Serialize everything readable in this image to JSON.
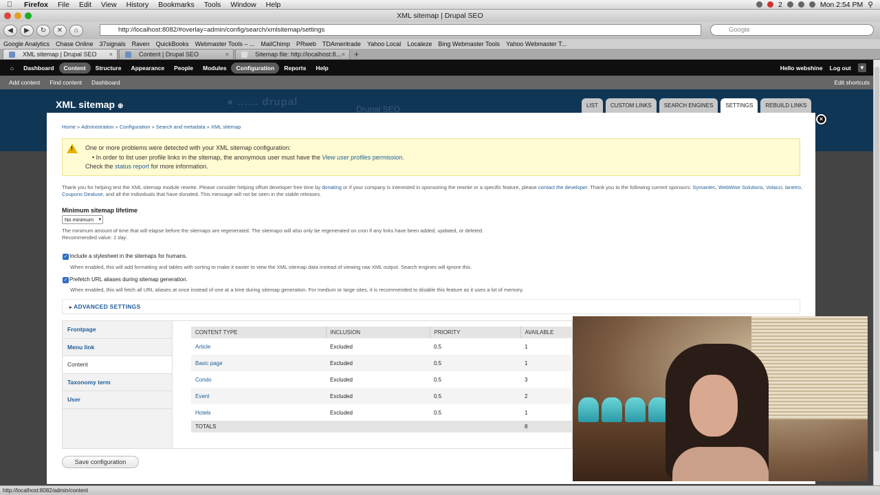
{
  "os_menu": {
    "app": "Firefox",
    "items": [
      "File",
      "Edit",
      "View",
      "History",
      "Bookmarks",
      "Tools",
      "Window",
      "Help"
    ],
    "clock": "Mon 2:54 PM",
    "badge": "2"
  },
  "window_title": "XML sitemap | Drupal SEO",
  "address": {
    "url": "http://localhost:8082/#overlay=admin/config/search/xmlsitemap/settings",
    "search_placeholder": "Google"
  },
  "bookmarks": [
    "Google Analytics",
    "Chase Online",
    "37signals",
    "Raven",
    "QuickBooks",
    "Webmaster Tools – ...",
    "MailChimp",
    "PRweb",
    "TDAmeritrade",
    "Yahoo Local",
    "Localeze",
    "Bing Webmaster Tools",
    "Yahoo Webmaster T..."
  ],
  "tabs": [
    {
      "label": "XML sitemap | Drupal SEO"
    },
    {
      "label": "Content | Drupal SEO"
    },
    {
      "label": "Sitemap file: http://localhost:8..."
    }
  ],
  "admin_toolbar": {
    "items": [
      "Dashboard",
      "Content",
      "Structure",
      "Appearance",
      "People",
      "Modules",
      "Configuration",
      "Reports",
      "Help"
    ],
    "greeting": "Hello webshine",
    "logout": "Log out"
  },
  "shortcuts": {
    "items": [
      "Add content",
      "Find content",
      "Dashboard"
    ],
    "edit": "Edit shortcuts"
  },
  "page": {
    "title": "XML sitemap",
    "watermark": "Drupal SEO",
    "tabs": [
      "LIST",
      "CUSTOM LINKS",
      "SEARCH ENGINES",
      "SETTINGS",
      "REBUILD LINKS"
    ],
    "breadcrumb": [
      "Home",
      "Administration",
      "Configuration",
      "Search and metadata",
      "XML sitemap"
    ]
  },
  "warning": {
    "line1": "One or more problems were detected with your XML sitemap configuration:",
    "line2_pre": "In order to list user profile links in the sitemap, the anonymous user must have the ",
    "line2_link": "View user profiles",
    "line2_post": " permission.",
    "line3_pre": "Check the ",
    "line3_link": "status report",
    "line3_post": " for more information."
  },
  "notice": {
    "t1": "Thank you for helping test the XML sitemap module rewrite. Please consider helping offset developer free time by ",
    "l1": "donating",
    "t2": " or if your company is interested in sponsoring the rewrite or a specific feature, please ",
    "l2": "contact the developer",
    "t3": ". Thank you to the following current sponsors: ",
    "l3": "Symantec",
    "t4": ", ",
    "l4": "WebWise Solutions",
    "l5": "Volacci",
    "l6": "lanetro",
    "l7": "Coupons Dealuxe",
    "t5": ", and all the individuals that have donated. This message will not be seen in the stable releases."
  },
  "lifetime": {
    "label": "Minimum sitemap lifetime",
    "value": "No minimum",
    "desc1": "The minimum amount of time that will elapse before the sitemaps are regenerated. The sitemaps will also only be regenerated on cron if any links have been added, updated, or deleted.",
    "desc2_pre": "Recommended value: ",
    "desc2_val": "1 day",
    "desc2_post": "."
  },
  "stylesheet": {
    "label": "Include a stylesheet in the sitemaps for humans.",
    "desc": "When enabled, this will add formatting and tables with sorting to make it easier to view the XML sitemap data instead of viewing raw XML output. Search engines will ignore this."
  },
  "prefetch": {
    "label": "Prefetch URL aliases during sitemap generation.",
    "desc": "When enabled, this will fetch all URL aliases at once instead of one at a time during sitemap generation. For medium or large sites, it is recommended to disable this feature as it uses a lot of memory."
  },
  "advanced": "ADVANCED SETTINGS",
  "vtabs": [
    "Frontpage",
    "Menu link",
    "Content",
    "Taxonomy term",
    "User"
  ],
  "table": {
    "headers": [
      "CONTENT TYPE",
      "INCLUSION",
      "PRIORITY",
      "AVAILABLE"
    ],
    "rows": [
      [
        "Article",
        "Excluded",
        "0.5",
        "1"
      ],
      [
        "Basic page",
        "Excluded",
        "0.5",
        "1"
      ],
      [
        "Condo",
        "Excluded",
        "0.5",
        "3"
      ],
      [
        "Event",
        "Excluded",
        "0.5",
        "2"
      ],
      [
        "Hotels",
        "Excluded",
        "0.5",
        "1"
      ]
    ],
    "totals_label": "TOTALS",
    "totals_value": "8"
  },
  "save_label": "Save configuration",
  "status_url": "http://localhost:8082/admin/content",
  "colors": {
    "toolbar": "#0f0f0f",
    "link": "#1f5d99",
    "header_band": "#103656",
    "warning_bg": "#fffbd2"
  }
}
